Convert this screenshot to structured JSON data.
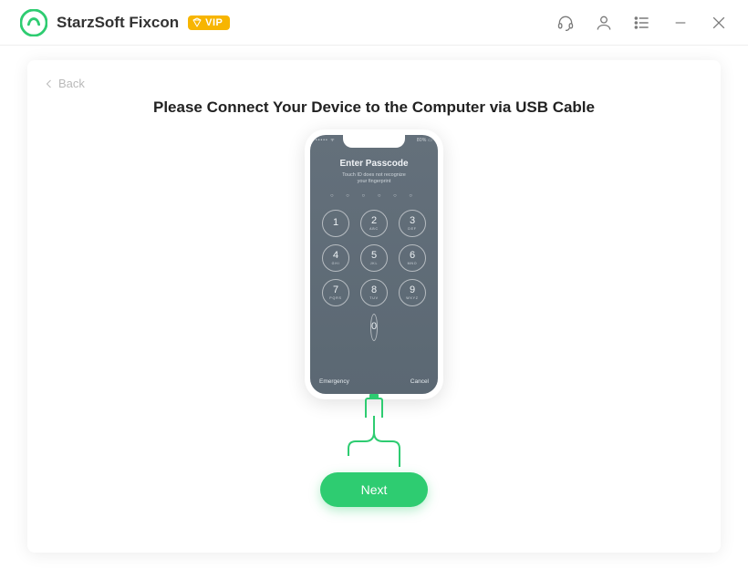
{
  "app": {
    "title": "StarzSoft Fixcon",
    "vip_label": "VIP"
  },
  "colors": {
    "accent": "#2ecc71",
    "vip": "#f7b500"
  },
  "titlebar_icons": {
    "support": "headset-icon",
    "account": "user-icon",
    "menu": "menu-icon",
    "minimize": "minimize-icon",
    "close": "close-icon"
  },
  "page": {
    "back_label": "Back",
    "heading": "Please Connect Your Device to the Computer via USB Cable",
    "next_label": "Next"
  },
  "phone": {
    "status_left": "••••• ᯤ",
    "status_right": "80% ▭",
    "title": "Enter Passcode",
    "subtitle_line1": "Touch ID does not recognize",
    "subtitle_line2": "your fingerprint",
    "code_dots": "○ ○ ○ ○ ○ ○",
    "keys": [
      {
        "num": "1",
        "let": ""
      },
      {
        "num": "2",
        "let": "ABC"
      },
      {
        "num": "3",
        "let": "DEF"
      },
      {
        "num": "4",
        "let": "GHI"
      },
      {
        "num": "5",
        "let": "JKL"
      },
      {
        "num": "6",
        "let": "MNO"
      },
      {
        "num": "7",
        "let": "PQRS"
      },
      {
        "num": "8",
        "let": "TUV"
      },
      {
        "num": "9",
        "let": "WXYZ"
      },
      {
        "num": "0",
        "let": ""
      }
    ],
    "emergency": "Emergency",
    "cancel": "Cancel"
  }
}
